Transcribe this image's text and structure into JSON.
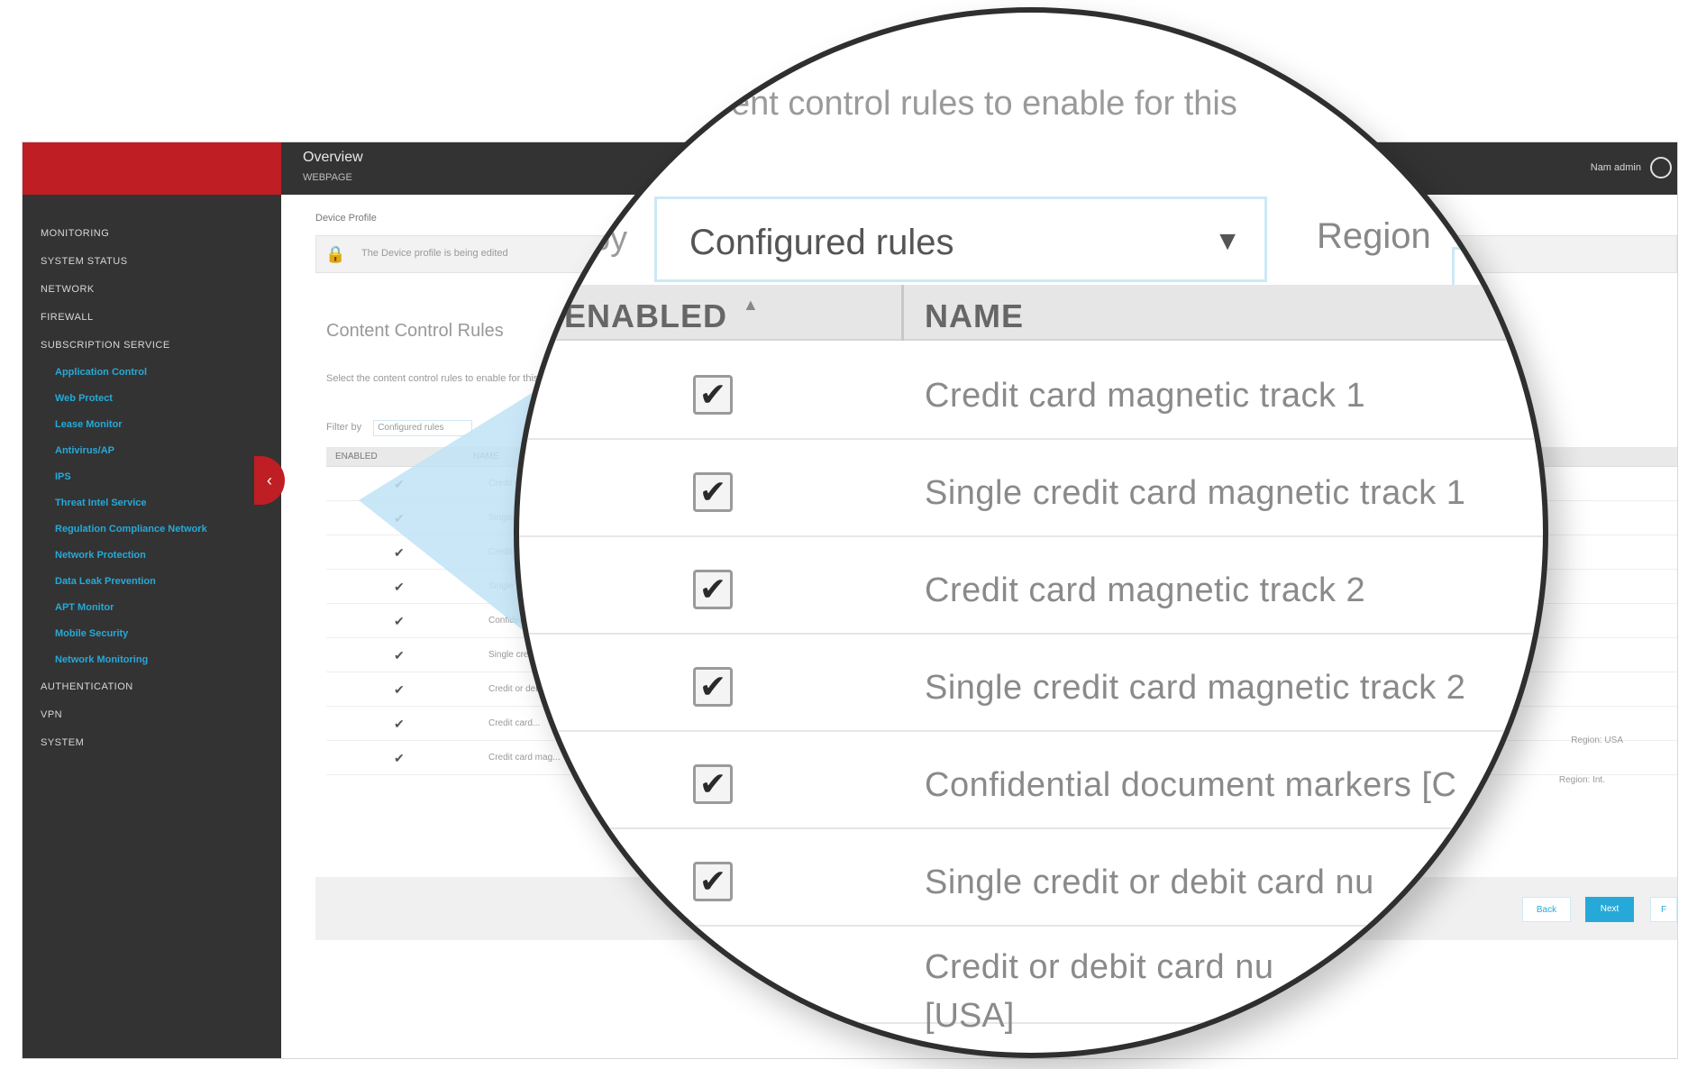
{
  "app": {
    "topbar": {
      "title": "Overview",
      "subtitle": "WEBPAGE",
      "user": "Nam admin"
    },
    "breadcrumb": "Device Profile",
    "lock_notice": "The Device profile is being edited",
    "nav": [
      {
        "label": "MONITORING",
        "type": "top"
      },
      {
        "label": "SYSTEM STATUS",
        "type": "top"
      },
      {
        "label": "NETWORK",
        "type": "top"
      },
      {
        "label": "FIREWALL",
        "type": "top"
      },
      {
        "label": "SUBSCRIPTION SERVICE",
        "type": "top"
      },
      {
        "label": "Application Control",
        "type": "sub"
      },
      {
        "label": "Web Protect",
        "type": "sub"
      },
      {
        "label": "Lease Monitor",
        "type": "sub"
      },
      {
        "label": "Antivirus/AP",
        "type": "sub"
      },
      {
        "label": "IPS",
        "type": "sub"
      },
      {
        "label": "Threat Intel Service",
        "type": "sub"
      },
      {
        "label": "Regulation Compliance Network",
        "type": "sub"
      },
      {
        "label": "Network Protection",
        "type": "sub"
      },
      {
        "label": "Data Leak Prevention",
        "type": "sub"
      },
      {
        "label": "APT Monitor",
        "type": "sub"
      },
      {
        "label": "Mobile Security",
        "type": "sub"
      },
      {
        "label": "Network Monitoring",
        "type": "sub"
      },
      {
        "label": "AUTHENTICATION",
        "type": "top"
      },
      {
        "label": "VPN",
        "type": "top"
      },
      {
        "label": "SYSTEM",
        "type": "top"
      }
    ],
    "section_title": "Content Control Rules",
    "section_desc": "Select the content control rules to enable for this",
    "filter_label": "Filter by",
    "filter_value": "Configured rules",
    "mini_headers": [
      "ENABLED",
      "NAME"
    ],
    "mini_rows": [
      "Credit card...",
      "Single credit...",
      "Credit card...",
      "Single credit...",
      "Confidential...",
      "Single credit...",
      "Credit or debit...",
      "Credit card...",
      "Credit card mag..."
    ],
    "side_notes": [
      "Region: USA",
      "Region: Int."
    ],
    "pager": {
      "prev": "Back",
      "next": "Next",
      "last": "F"
    }
  },
  "lens": {
    "description": "ent control rules to enable for this",
    "filter_by_fragment": "by",
    "filter_selected": "Configured rules",
    "region_label": "Region",
    "columns": {
      "enabled": "ENABLED",
      "name": "NAME"
    },
    "rows": [
      {
        "name": "Credit card magnetic track 1",
        "checked": true
      },
      {
        "name": "Single credit card magnetic track 1",
        "checked": true
      },
      {
        "name": "Credit card magnetic track 2",
        "checked": true
      },
      {
        "name": "Single credit card magnetic track 2",
        "checked": true
      },
      {
        "name": "Confidential document markers [C",
        "checked": true
      },
      {
        "name": "Single credit or debit card nu",
        "checked": true
      },
      {
        "name": "Credit or debit card nu",
        "name_line2": "[USA]",
        "checked": true
      }
    ]
  },
  "colors": {
    "brand_red": "#be1e24",
    "sidebar": "#333333",
    "accent": "#26a9d8",
    "wedge": "#bfe3f6"
  },
  "icons": {
    "lock": "lock-icon",
    "sort": "sort-asc-icon",
    "dropdown": "chevron-down-icon",
    "collapse": "chevron-left-icon",
    "check": "checkmark-icon"
  }
}
